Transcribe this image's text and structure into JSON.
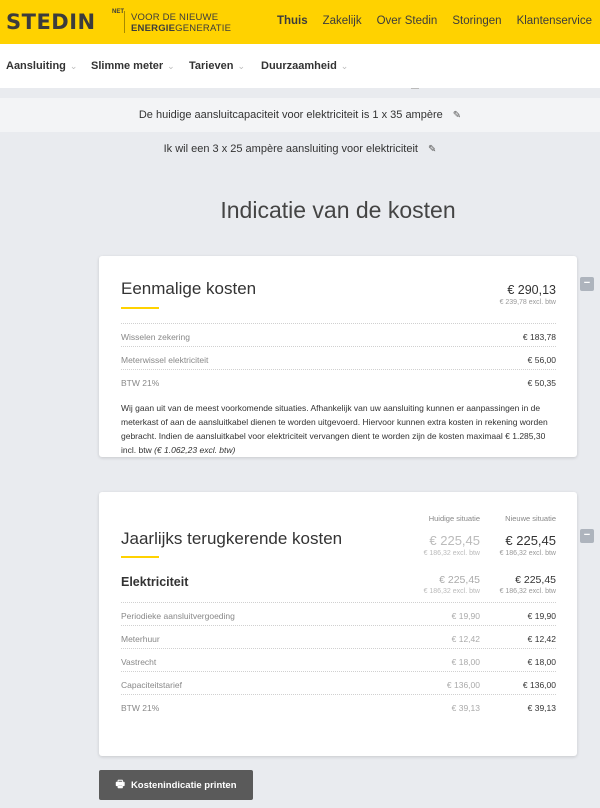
{
  "brand": {
    "logo": "STEDIN",
    "logo_suffix": "NET",
    "tagline_line1": "VOOR DE NIEUWE",
    "tagline_bold": "ENERGIE",
    "tagline_rest": "GENERATIE"
  },
  "topnav": [
    "Thuis",
    "Zakelijk",
    "Over Stedin",
    "Storingen",
    "Klantenservice"
  ],
  "subnav": [
    "Aansluiting",
    "Slimme meter",
    "Tarieven",
    "Duurzaamheid"
  ],
  "info": {
    "current_capacity": "De huidige aansluitcapaciteit voor elektriciteit is 1 x 35 ampère",
    "desired_connection": "Ik wil een 3 x 25 ampère aansluiting voor elektriciteit"
  },
  "page_title": "Indicatie van de kosten",
  "eenmalig": {
    "title": "Eenmalige kosten",
    "total": "€ 290,13",
    "total_excl": "€ 239,78 excl. btw",
    "rows": [
      {
        "label": "Wisselen zekering",
        "value": "€ 183,78"
      },
      {
        "label": "Meterwissel elektriciteit",
        "value": "€ 56,00"
      },
      {
        "label": "BTW 21%",
        "value": "€ 50,35"
      }
    ],
    "description": "Wij gaan uit van de meest voorkomende situaties. Afhankelijk van uw aansluiting kunnen er aanpassingen in de meterkast of aan de aansluitkabel dienen te worden uitgevoerd. Hiervoor kunnen extra kosten in rekening worden gebracht. Indien de aansluitkabel voor elektriciteit vervangen dient te worden zijn de kosten maximaal € 1.285,30 incl. btw",
    "description_italic": "(€ 1.062,23 excl. btw)"
  },
  "jaarlijks": {
    "title": "Jaarlijks terugkerende kosten",
    "col_current": "Huidige situatie",
    "col_new": "Nieuwe situatie",
    "total_current": "€ 225,45",
    "total_current_excl": "€ 186,32 excl. btw",
    "total_new": "€ 225,45",
    "total_new_excl": "€ 186,32 excl. btw",
    "section": "Elektriciteit",
    "section_current": "€ 225,45",
    "section_current_excl": "€ 186,32 excl. btw",
    "section_new": "€ 225,45",
    "section_new_excl": "€ 186,32 excl. btw",
    "rows": [
      {
        "label": "Periodieke aansluitvergoeding",
        "current": "€ 19,90",
        "new": "€ 19,90"
      },
      {
        "label": "Meterhuur",
        "current": "€ 12,42",
        "new": "€ 12,42"
      },
      {
        "label": "Vastrecht",
        "current": "€ 18,00",
        "new": "€ 18,00"
      },
      {
        "label": "Capaciteitstarief",
        "current": "€ 136,00",
        "new": "€ 136,00"
      },
      {
        "label": "BTW 21%",
        "current": "€ 39,13",
        "new": "€ 39,13"
      }
    ]
  },
  "print_label": "Kostenindicatie printen",
  "collapse_symbol": "−",
  "icons": {
    "pencil": "✎",
    "printer": "🖶",
    "chevron": "⌄"
  }
}
